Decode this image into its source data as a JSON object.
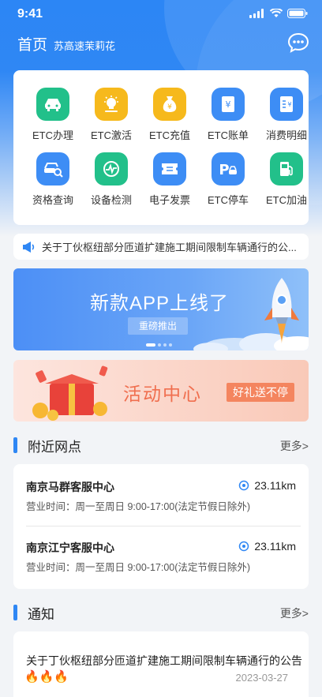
{
  "status": {
    "time": "9:41"
  },
  "header": {
    "title": "首页",
    "region": "苏高速茉莉花"
  },
  "services": [
    {
      "label": "ETC办理",
      "icon": "car-icon",
      "color": "#22c08a"
    },
    {
      "label": "ETC激活",
      "icon": "bulb-icon",
      "color": "#f6b91c"
    },
    {
      "label": "ETC充值",
      "icon": "money-bag-icon",
      "color": "#f6b91c"
    },
    {
      "label": "ETC账单",
      "icon": "bill-icon",
      "color": "#3d8df5"
    },
    {
      "label": "消费明细",
      "icon": "receipt-icon",
      "color": "#3d8df5"
    },
    {
      "label": "资格查询",
      "icon": "car-search-icon",
      "color": "#3d8df5"
    },
    {
      "label": "设备检测",
      "icon": "device-check-icon",
      "color": "#22c08a"
    },
    {
      "label": "电子发票",
      "icon": "ticket-icon",
      "color": "#3d8df5"
    },
    {
      "label": "ETC停车",
      "icon": "parking-icon",
      "color": "#3d8df5"
    },
    {
      "label": "ETC加油",
      "icon": "fuel-icon",
      "color": "#22c08a"
    }
  ],
  "notice": {
    "text": "关于丁伙枢纽部分匝道扩建施工期间限制车辆通行的公..."
  },
  "banner_app": {
    "title": "新款APP上线了",
    "button": "重磅推出"
  },
  "banner_activity": {
    "title": "活动中心",
    "tag": "好礼送不停"
  },
  "nearby": {
    "title": "附近网点",
    "more": "更多>",
    "items": [
      {
        "name": "南京马群客服中心",
        "distance": "23.11km",
        "hours": "营业时间：周一至周日 9:00-17:00(法定节假日除外)"
      },
      {
        "name": "南京江宁客服中心",
        "distance": "23.11km",
        "hours": "营业时间：周一至周日 9:00-17:00(法定节假日除外)"
      }
    ]
  },
  "notices_section": {
    "title": "通知",
    "more": "更多>",
    "items": [
      {
        "text": "关于丁伙枢纽部分匝道扩建施工期间限制车辆通行的公告",
        "fire": "🔥🔥🔥",
        "date": "2023-03-27"
      }
    ]
  }
}
